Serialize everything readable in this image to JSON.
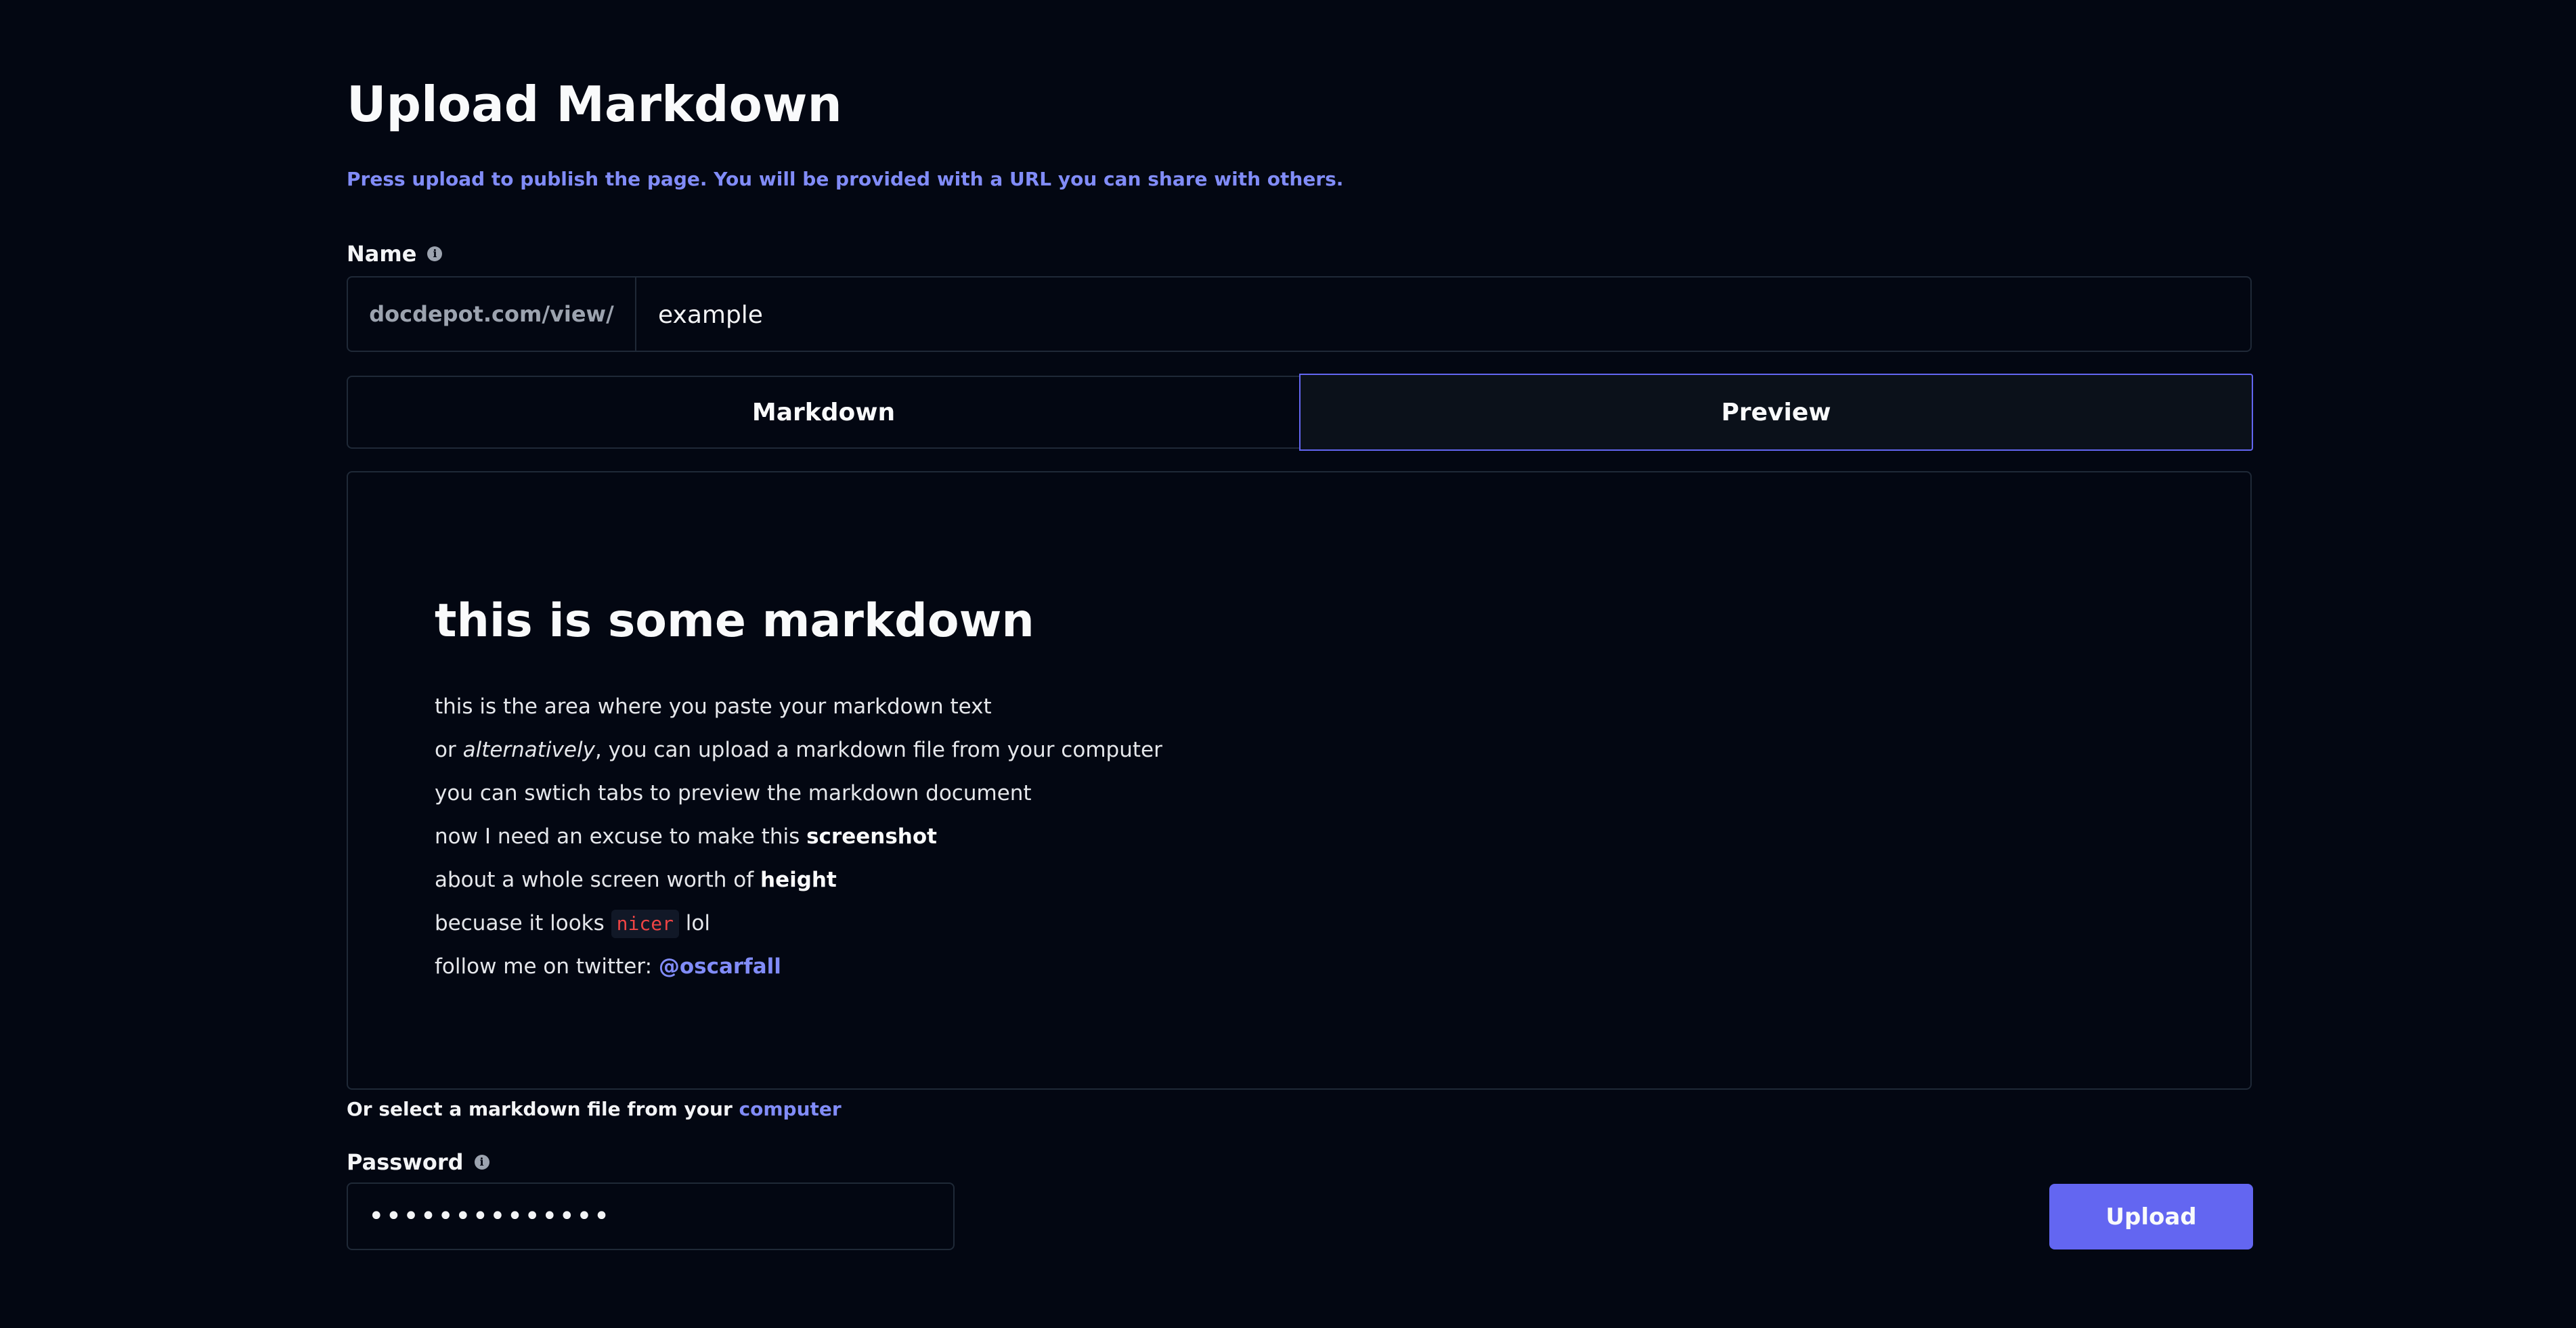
{
  "header": {
    "title": "Upload Markdown",
    "subtitle": "Press upload to publish the page. You will be provided with a URL you can share with others."
  },
  "name_field": {
    "label": "Name",
    "info_icon": "info-icon",
    "prefix": "docdepot.com/view/",
    "value": "example"
  },
  "tabs": [
    {
      "label": "Markdown",
      "active": false
    },
    {
      "label": "Preview",
      "active": true
    }
  ],
  "preview": {
    "heading": "this is some markdown",
    "line1": "this is the area where you paste your markdown text",
    "line2_prefix": "or ",
    "line2_italic": "alternatively",
    "line2_suffix": ", you can upload a markdown file from your computer",
    "line3": "you can swtich tabs to preview the markdown document",
    "line4_prefix": "now I need an excuse to make this ",
    "line4_bold": "screenshot",
    "line5_prefix": "about a whole screen worth of ",
    "line5_bold": "height",
    "line6_prefix": "becuase it looks ",
    "line6_code": "nicer",
    "line6_suffix": " lol",
    "line7_prefix": "follow me on twitter: ",
    "line7_link": "@oscarfall"
  },
  "file_select": {
    "text": "Or select a markdown file from your ",
    "link": "computer"
  },
  "password_field": {
    "label": "Password",
    "info_icon": "info-icon",
    "value": "••••••••••••••"
  },
  "upload_button": {
    "label": "Upload"
  },
  "colors": {
    "background": "#030712",
    "accent": "#6366f1",
    "link": "#818cf8",
    "code": "#ef4444"
  }
}
